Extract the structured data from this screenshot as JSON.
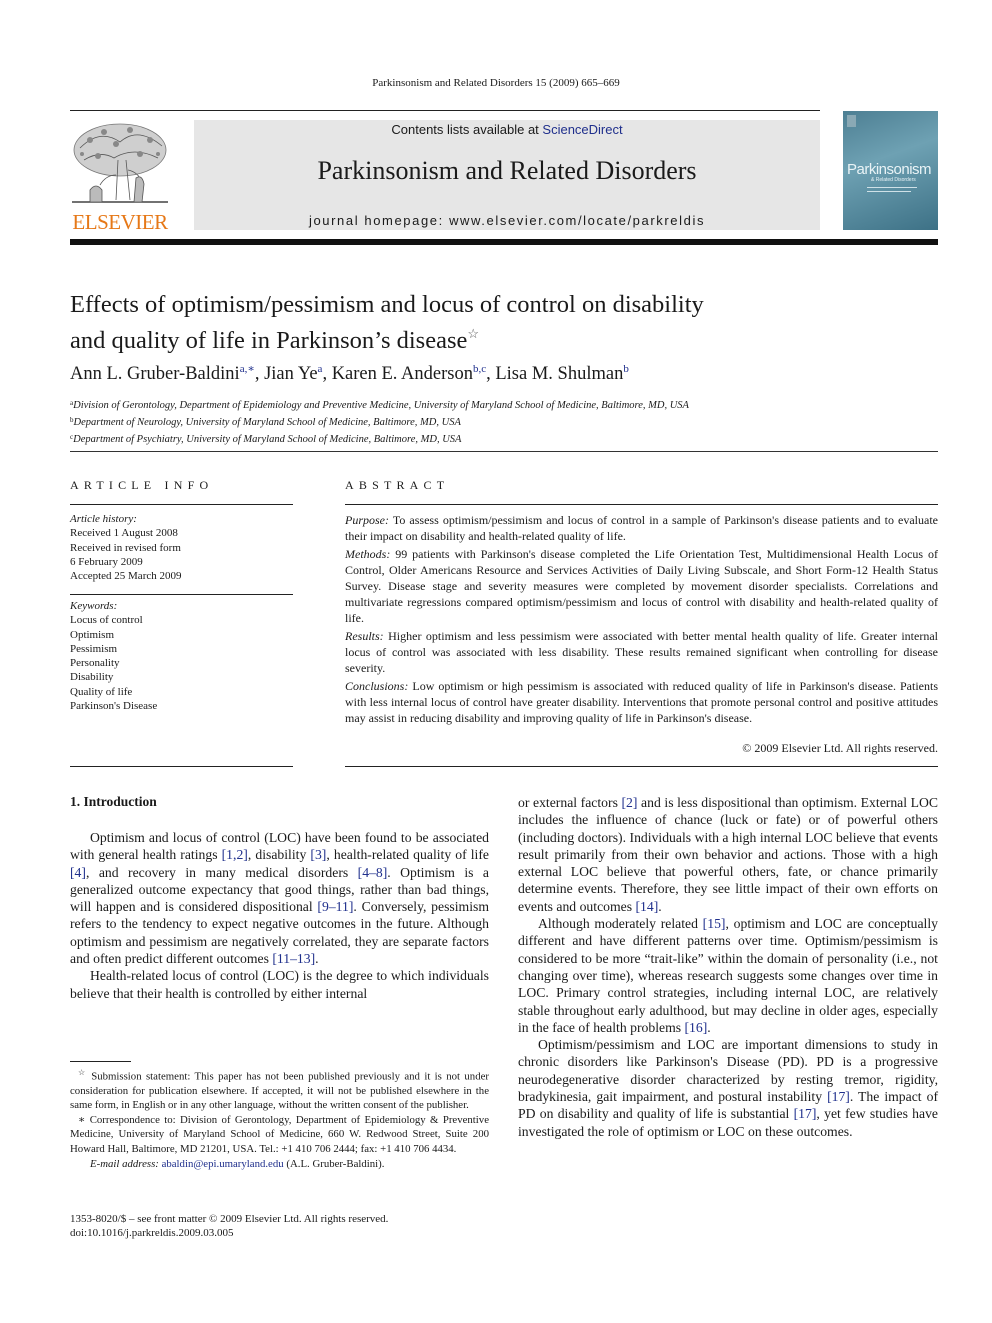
{
  "running_head": "Parkinsonism and Related Disorders 15 (2009) 665–669",
  "header": {
    "publisher": "ELSEVIER",
    "contents_prefix": "Contents lists available at ",
    "contents_link": "ScienceDirect",
    "journal_title": "Parkinsonism and Related Disorders",
    "homepage_prefix": "journal homepage: ",
    "homepage_url": "www.elsevier.com/locate/parkreldis",
    "cover_title": "Parkinsonism",
    "cover_subtitle": "& Related Disorders",
    "colors": {
      "publisher_orange": "#e67817",
      "link_blue": "#1f2f8c",
      "banner_gray": "#e6e6e6"
    }
  },
  "article": {
    "title_line1": "Effects of optimism/pessimism and locus of control on disability",
    "title_line2": "and quality of life in Parkinson’s disease",
    "title_mark": "☆",
    "authors": [
      {
        "name": "Ann L. Gruber-Baldini",
        "sup": "a,",
        "mark": "∗",
        "sep": ", "
      },
      {
        "name": "Jian Ye",
        "sup": "a",
        "mark": "",
        "sep": ", "
      },
      {
        "name": "Karen E. Anderson",
        "sup": "b,c",
        "mark": "",
        "sep": ", "
      },
      {
        "name": "Lisa M. Shulman",
        "sup": "b",
        "mark": "",
        "sep": ""
      }
    ],
    "affiliations": [
      {
        "key": "a",
        "text": "Division of Gerontology, Department of Epidemiology and Preventive Medicine, University of Maryland School of Medicine, Baltimore, MD, USA"
      },
      {
        "key": "b",
        "text": "Department of Neurology, University of Maryland School of Medicine, Baltimore, MD, USA"
      },
      {
        "key": "c",
        "text": "Department of Psychiatry, University of Maryland School of Medicine, Baltimore, MD, USA"
      }
    ]
  },
  "article_info": {
    "heading": "ARTICLE INFO",
    "history_label": "Article history:",
    "history": [
      "Received 1 August 2008",
      "Received in revised form",
      "6 February 2009",
      "Accepted 25 March 2009"
    ],
    "keywords_label": "Keywords:",
    "keywords": [
      "Locus of control",
      "Optimism",
      "Pessimism",
      "Personality",
      "Disability",
      "Quality of life",
      "Parkinson's Disease"
    ]
  },
  "abstract": {
    "heading": "ABSTRACT",
    "sections": [
      {
        "label": "Purpose:",
        "text": " To assess optimism/pessimism and locus of control in a sample of Parkinson's disease patients and to evaluate their impact on disability and health-related quality of life."
      },
      {
        "label": "Methods:",
        "text": " 99 patients with Parkinson's disease completed the Life Orientation Test, Multidimensional Health Locus of Control, Older Americans Resource and Services Activities of Daily Living Subscale, and Short Form-12 Health Status Survey. Disease stage and severity measures were completed by movement disorder specialists. Correlations and multivariate regressions compared optimism/pessimism and locus of control with disability and health-related quality of life."
      },
      {
        "label": "Results:",
        "text": " Higher optimism and less pessimism were associated with better mental health quality of life. Greater internal locus of control was associated with less disability. These results remained significant when controlling for disease severity."
      },
      {
        "label": "Conclusions:",
        "text": " Low optimism or high pessimism is associated with reduced quality of life in Parkinson's disease. Patients with less internal locus of control have greater disability. Interventions that promote personal control and positive attitudes may assist in reducing disability and improving quality of life in Parkinson's disease."
      }
    ],
    "copyright": "© 2009 Elsevier Ltd. All rights reserved."
  },
  "body": {
    "section_heading": "1.  Introduction",
    "left_paragraphs": [
      [
        {
          "t": "Optimism and locus of control (LOC) have been found to be associated with general health ratings "
        },
        {
          "t": "[1,2]",
          "ref": true
        },
        {
          "t": ", disability "
        },
        {
          "t": "[3]",
          "ref": true
        },
        {
          "t": ", health-related quality of life "
        },
        {
          "t": "[4]",
          "ref": true
        },
        {
          "t": ", and recovery in many medical disorders "
        },
        {
          "t": "[4–8]",
          "ref": true
        },
        {
          "t": ". Optimism is a generalized outcome expectancy that good things, rather than bad things, will happen and is considered dispositional "
        },
        {
          "t": "[9–11]",
          "ref": true
        },
        {
          "t": ". Conversely, pessimism refers to the tendency to expect negative outcomes in the future. Although optimism and pessimism are negatively correlated, they are separate factors and often predict different outcomes "
        },
        {
          "t": "[11–13]",
          "ref": true
        },
        {
          "t": "."
        }
      ],
      [
        {
          "t": "Health-related locus of control (LOC) is the degree to which individuals believe that their health is controlled by either internal"
        }
      ]
    ],
    "right_paragraphs": [
      [
        {
          "t": "or external factors "
        },
        {
          "t": "[2]",
          "ref": true
        },
        {
          "t": " and is less dispositional than optimism. External LOC includes the influence of chance (luck or fate) or of powerful others (including doctors). Individuals with a high internal LOC believe that events result primarily from their own behavior and actions. Those with a high external LOC believe that powerful others, fate, or chance primarily determine events. Therefore, they see little impact of their own efforts on events and outcomes "
        },
        {
          "t": "[14]",
          "ref": true
        },
        {
          "t": "."
        }
      ],
      [
        {
          "t": "Although moderately related "
        },
        {
          "t": "[15]",
          "ref": true
        },
        {
          "t": ", optimism and LOC are conceptually different and have different patterns over time. Optimism/pessimism is considered to be more “trait-like” within the domain of personality (i.e., not changing over time), whereas research suggests some changes over time in LOC. Primary control strategies, including internal LOC, are relatively stable throughout early adulthood, but may decline in older ages, especially in the face of health problems "
        },
        {
          "t": "[16]",
          "ref": true
        },
        {
          "t": "."
        }
      ],
      [
        {
          "t": "Optimism/pessimism and LOC are important dimensions to study in chronic disorders like Parkinson's Disease (PD). PD is a progressive neurodegenerative disorder characterized by resting tremor, rigidity, bradykinesia, gait impairment, and postural instability "
        },
        {
          "t": "[17]",
          "ref": true
        },
        {
          "t": ". The impact of PD on disability and quality of life is substantial "
        },
        {
          "t": "[17]",
          "ref": true
        },
        {
          "t": ", yet few studies have investigated the role of optimism or LOC on these outcomes."
        }
      ]
    ]
  },
  "footnotes": {
    "submission_mark": "☆",
    "submission": " Submission statement: This paper has not been published previously and it is not under consideration for publication elsewhere. If accepted, it will not be published elsewhere in the same form, in English or in any other language, without the written consent of the publisher.",
    "correspondence_mark": "∗",
    "correspondence": " Correspondence to: Division of Gerontology, Department of Epidemiology & Preventive Medicine, University of Maryland School of Medicine, 660 W. Redwood Street, Suite 200 Howard Hall, Baltimore, MD 21201, USA. Tel.: +1 410 706 2444; fax: +1 410 706 4434.",
    "email_label": "E-mail address:",
    "email": "abaldin@epi.umaryland.edu",
    "email_owner": " (A.L. Gruber-Baldini)."
  },
  "issn_line": "1353-8020/$ – see front matter © 2009 Elsevier Ltd. All rights reserved.",
  "doi_line": "doi:10.1016/j.parkreldis.2009.03.005"
}
